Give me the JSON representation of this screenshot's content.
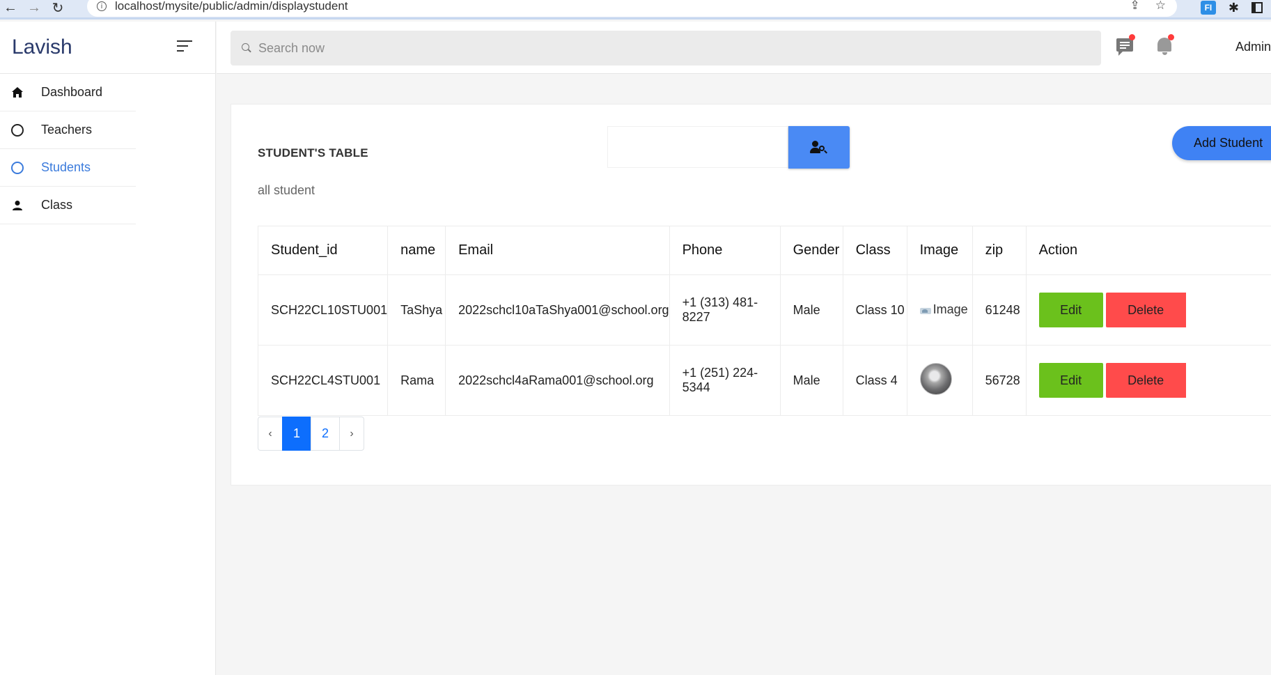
{
  "browser": {
    "url": "localhost/mysite/public/admin/displaystudent",
    "back": "←",
    "forward": "→",
    "reload": "↻",
    "share": "⇪",
    "star": "☆",
    "ext_label": "FI",
    "puzzle": "✱"
  },
  "sidebar": {
    "brand": "Lavish",
    "items": [
      {
        "label": "Dashboard",
        "icon": "home-icon"
      },
      {
        "label": "Teachers",
        "icon": "circle-icon"
      },
      {
        "label": "Students",
        "icon": "circle-icon",
        "active": true
      },
      {
        "label": "Class",
        "icon": "person-icon"
      }
    ]
  },
  "topbar": {
    "search_placeholder": "Search now",
    "admin": "Admin",
    "notification_color": "#ff3b3b"
  },
  "card": {
    "title": "STUDENT'S TABLE",
    "subtitle": "all student",
    "add_button": "Add Student"
  },
  "table": {
    "headers": [
      "Student_id",
      "name",
      "Email",
      "Phone",
      "Gender",
      "Class",
      "Image",
      "zip",
      "Action"
    ],
    "rows": [
      {
        "id": "SCH22CL10STU001",
        "name": "TaShya",
        "email": "2022schcl10aTaShya001@school.org",
        "phone": "+1 (313) 481-8227",
        "gender": "Male",
        "class": "Class 10",
        "image": "Image",
        "zip": "61248",
        "edit": "Edit",
        "delete": "Delete"
      },
      {
        "id": "SCH22CL4STU001",
        "name": "Rama",
        "email": "2022schcl4aRama001@school.org",
        "phone": "+1 (251) 224-5344",
        "gender": "Male",
        "class": "Class 4",
        "image": "",
        "zip": "56728",
        "edit": "Edit",
        "delete": "Delete"
      }
    ]
  },
  "pagination": {
    "prev": "‹",
    "pages": [
      "1",
      "2"
    ],
    "active": "1",
    "next": "›"
  },
  "colors": {
    "accent": "#3b7bdc",
    "edit": "#6bc11c",
    "delete": "#ff4b4b",
    "search_button": "#4a8af4"
  }
}
